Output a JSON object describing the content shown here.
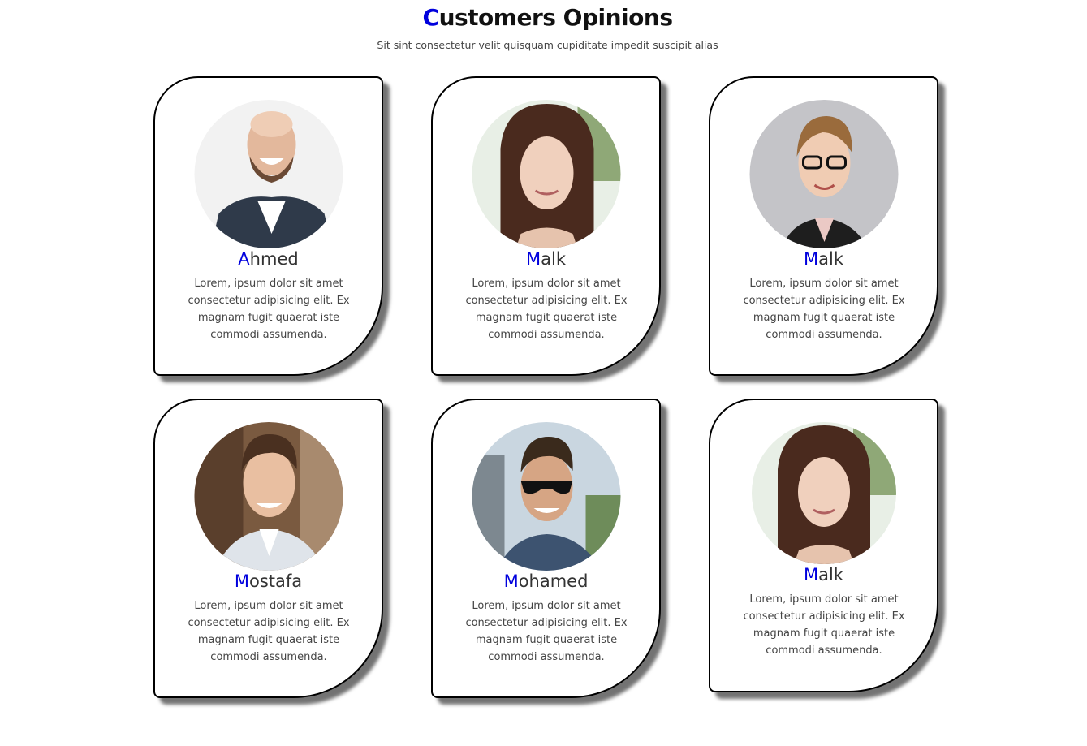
{
  "header": {
    "title_first": "C",
    "title_rest": "ustomers Opinions",
    "subtitle": "Sit sint consectetur velit quisquam cupiditate impedit suscipit alias"
  },
  "accent_color": "#0000dd",
  "cards": [
    {
      "initial": "A",
      "rest": "hmed",
      "text": "Lorem, ipsum dolor sit amet consectetur adipisicing elit. Ex magnam fugit quaerat iste commodi assumenda.",
      "photo": "bald-laughing-man-photo"
    },
    {
      "initial": "M",
      "rest": "alk",
      "text": "Lorem, ipsum dolor sit amet consectetur adipisicing elit. Ex magnam fugit quaerat iste commodi assumenda.",
      "photo": "smiling-woman-photo"
    },
    {
      "initial": "M",
      "rest": "alk",
      "text": "Lorem, ipsum dolor sit amet consectetur adipisicing elit. Ex magnam fugit quaerat iste commodi assumenda.",
      "photo": "woman-with-glasses-photo"
    },
    {
      "initial": "M",
      "rest": "ostafa",
      "text": "Lorem, ipsum dolor sit amet consectetur adipisicing elit. Ex magnam fugit quaerat iste commodi assumenda.",
      "photo": "young-man-smiling-photo"
    },
    {
      "initial": "M",
      "rest": "ohamed",
      "text": "Lorem, ipsum dolor sit amet consectetur adipisicing elit. Ex magnam fugit quaerat iste commodi assumenda.",
      "photo": "man-with-sunglasses-photo"
    },
    {
      "initial": "M",
      "rest": "alk",
      "text": "Lorem, ipsum dolor sit amet consectetur adipisicing elit. Ex magnam fugit quaerat iste commodi assumenda.",
      "photo": "smiling-woman-photo"
    }
  ]
}
